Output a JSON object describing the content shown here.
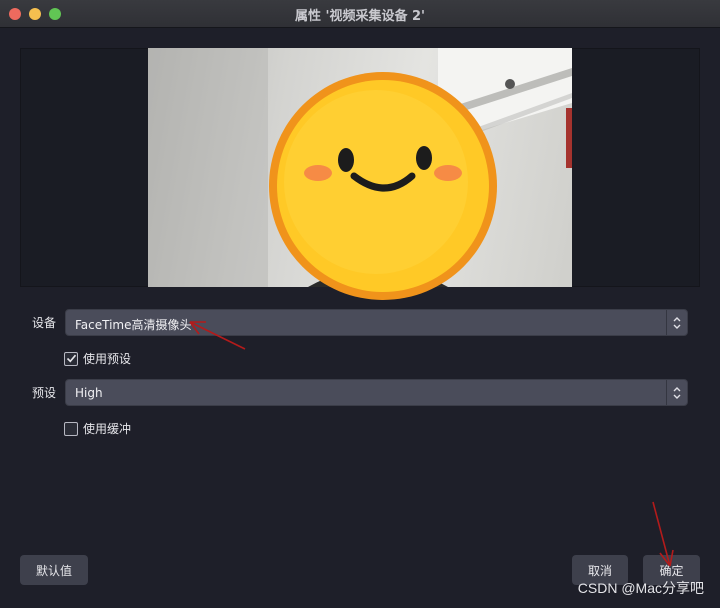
{
  "window": {
    "title": "属性 '视频采集设备 2'"
  },
  "form": {
    "device_label": "设备",
    "device_value": "FaceTime高清摄像头",
    "use_preset_label": "使用预设",
    "use_preset_checked": true,
    "preset_label": "预设",
    "preset_value": "High",
    "use_buffer_label": "使用缓冲",
    "use_buffer_checked": false
  },
  "buttons": {
    "defaults": "默认值",
    "cancel": "取消",
    "ok": "确定"
  },
  "watermark": "CSDN @Mac分享吧",
  "colors": {
    "background": "#1e1f29",
    "select": "#4a4c5a",
    "button": "#3e404c",
    "annotation": "#b31b1b"
  },
  "icons": {
    "select_stepper": "chevron-up-down-icon",
    "checkbox": "checkmark-icon",
    "annotation": "red-arrow-icon"
  }
}
